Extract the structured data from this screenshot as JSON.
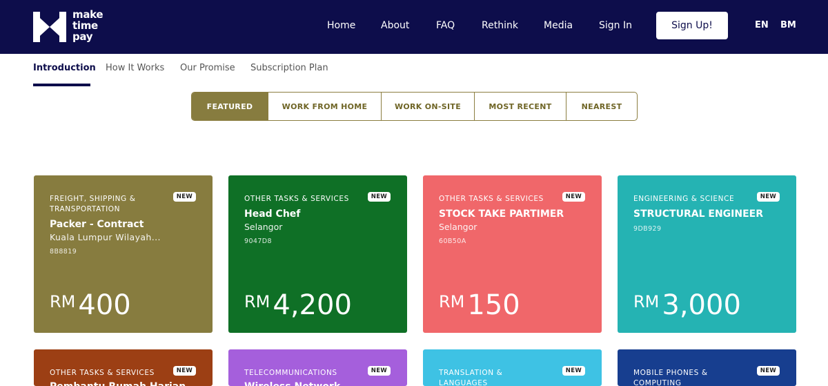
{
  "brand": {
    "logo_line1": "make",
    "logo_line2": "time",
    "logo_line3": "pay"
  },
  "nav": {
    "home": "Home",
    "about": "About",
    "faq": "FAQ",
    "rethink": "Rethink",
    "media": "Media",
    "signin": "Sign In",
    "signup": "Sign Up!",
    "lang_en": "EN",
    "lang_bm": "BM"
  },
  "subtabs": {
    "introduction": "Introduction",
    "how_it_works": "How It Works",
    "our_promise": "Our Promise",
    "subscription_plan": "Subscription Plan"
  },
  "filters": {
    "featured": "FEATURED",
    "work_from_home": "WORK FROM HOME",
    "work_on_site": "WORK ON-SITE",
    "most_recent": "MOST RECENT",
    "nearest": "NEAREST"
  },
  "cards": [
    {
      "category": "FREIGHT, SHIPPING & TRANSPORTATION",
      "badge": "NEW",
      "title": "Packer - Contract",
      "location": "Kuala Lumpur Wilayah...",
      "code": "8B8819",
      "currency": "RM",
      "amount": "400",
      "color": "#877c3f"
    },
    {
      "category": "OTHER TASKS & SERVICES",
      "badge": "NEW",
      "title": "Head Chef",
      "location": "Selangor",
      "code": "9047D8",
      "currency": "RM",
      "amount": "4,200",
      "color": "#0f7026"
    },
    {
      "category": "OTHER TASKS & SERVICES",
      "badge": "NEW",
      "title": "STOCK TAKE PARTIMER",
      "location": "Selangor",
      "code": "60B50A",
      "currency": "RM",
      "amount": "150",
      "color": "#f0676a"
    },
    {
      "category": "ENGINEERING & SCIENCE",
      "badge": "NEW",
      "title": "STRUCTURAL ENGINEER",
      "location": "",
      "code": "9DB929",
      "currency": "RM",
      "amount": "3,000",
      "color": "#25b3b3"
    },
    {
      "category": "OTHER TASKS & SERVICES",
      "badge": "NEW",
      "title": "Pembantu Rumah Harian",
      "color": "#9c3f14"
    },
    {
      "category": "TELECOMMUNICATIONS",
      "badge": "NEW",
      "title": "Wireless Network",
      "color": "#a55fdc"
    },
    {
      "category": "TRANSLATION & LANGUAGES",
      "badge": "NEW",
      "title": "",
      "color": "#3ec2e4"
    },
    {
      "category": "MOBILE PHONES & COMPUTING",
      "badge": "NEW",
      "title": "",
      "color": "#173e8f"
    }
  ]
}
